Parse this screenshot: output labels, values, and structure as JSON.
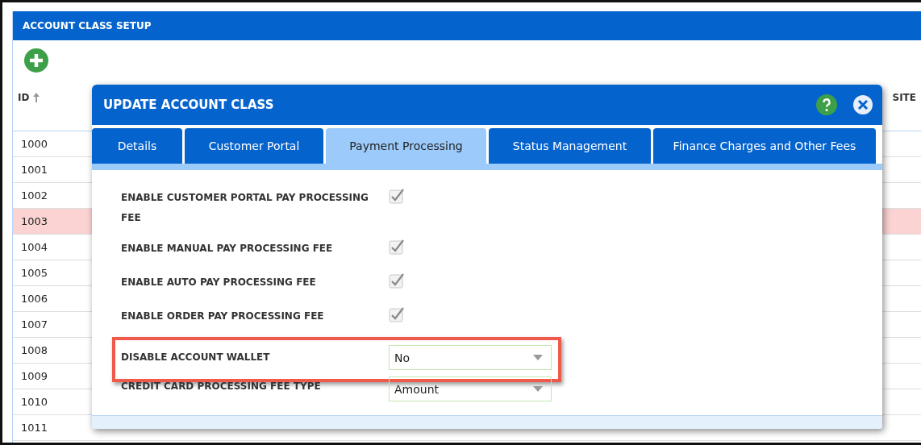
{
  "page": {
    "title": "ACCOUNT CLASS SETUP"
  },
  "table": {
    "columns": [
      {
        "label": "ID",
        "sorted": true
      },
      {
        "label": "SITE",
        "sorted": false
      }
    ],
    "rows": [
      {
        "id": "1000",
        "selected": false
      },
      {
        "id": "1001",
        "selected": false
      },
      {
        "id": "1002",
        "selected": false
      },
      {
        "id": "1003",
        "selected": true
      },
      {
        "id": "1004",
        "selected": false
      },
      {
        "id": "1005",
        "selected": false
      },
      {
        "id": "1006",
        "selected": false
      },
      {
        "id": "1007",
        "selected": false
      },
      {
        "id": "1008",
        "selected": false
      },
      {
        "id": "1009",
        "selected": false
      },
      {
        "id": "1010",
        "selected": false
      },
      {
        "id": "1011",
        "selected": false
      }
    ]
  },
  "dialog": {
    "title": "UPDATE ACCOUNT CLASS",
    "tabs": [
      {
        "label": "Details",
        "selected": false
      },
      {
        "label": "Customer Portal",
        "selected": false
      },
      {
        "label": "Payment Processing",
        "selected": true
      },
      {
        "label": "Status Management",
        "selected": false
      },
      {
        "label": "Finance Charges and Other Fees",
        "selected": false
      }
    ],
    "fields": [
      {
        "kind": "checkbox",
        "label": "ENABLE CUSTOMER PORTAL PAY PROCESSING FEE",
        "checked": true,
        "highlighted": false
      },
      {
        "kind": "checkbox",
        "label": "ENABLE MANUAL PAY PROCESSING FEE",
        "checked": true,
        "highlighted": false
      },
      {
        "kind": "checkbox",
        "label": "ENABLE AUTO PAY PROCESSING FEE",
        "checked": true,
        "highlighted": false
      },
      {
        "kind": "checkbox",
        "label": "ENABLE ORDER PAY PROCESSING FEE",
        "checked": true,
        "highlighted": false
      },
      {
        "kind": "select",
        "label": "DISABLE ACCOUNT WALLET",
        "value": "No",
        "highlighted": true
      },
      {
        "kind": "select",
        "label": "CREDIT CARD PROCESSING FEE TYPE",
        "value": "Amount",
        "highlighted": false
      }
    ]
  }
}
